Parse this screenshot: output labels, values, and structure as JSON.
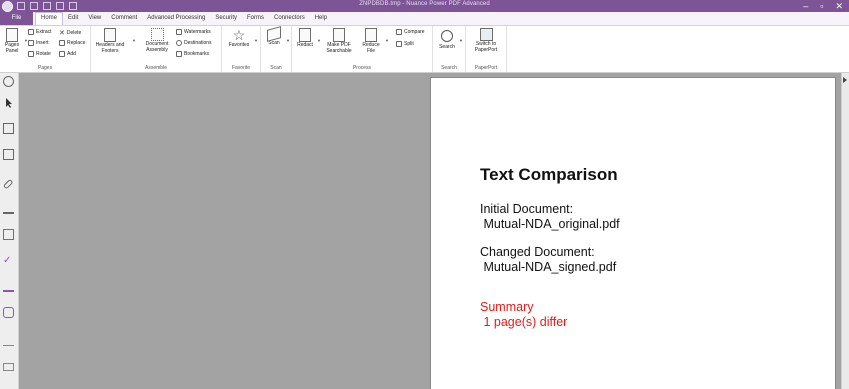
{
  "window": {
    "title": "ZNPDBDB.tmp - Nuance Power PDF Advanced",
    "min_label": "–",
    "restore_label": "▫",
    "close_label": "✕"
  },
  "menu": {
    "file": "File",
    "tabs": [
      "Home",
      "Edit",
      "View",
      "Comment",
      "Advanced Processing",
      "Security",
      "Forms",
      "Connectors",
      "Help"
    ]
  },
  "ribbon": {
    "pages_panel": "Pages Panel",
    "extract": "Extract",
    "delete": "Delete",
    "insert": "Insert",
    "replace": "Replace",
    "rotate": "Rotate",
    "add": "Add",
    "pages_group": "Pages",
    "headers_footers": "Headers and Footers",
    "document_assembly": "Document Assembly",
    "watermarks": "Watermarks",
    "destinations": "Destinations",
    "bookmarks": "Bookmarks",
    "assemble_group": "Assemble",
    "favorites": "Favorites",
    "favorite_group": "Favorite",
    "scan": "Scan",
    "scan_group": "Scan",
    "redact": "Redact",
    "make_pdf_searchable": "Make PDF Searchable",
    "reduce_file": "Reduce File",
    "compare": "Compare",
    "split": "Split",
    "process_group": "Process",
    "search": "Search",
    "search_group": "Search",
    "switch_paperport": "Switch to PaperPort",
    "paperport_group": "PaperPort"
  },
  "document": {
    "heading": "Text Comparison",
    "initial_label": "Initial Document:",
    "initial_file": " Mutual-NDA_original.pdf",
    "changed_label": "Changed Document:",
    "changed_file": " Mutual-NDA_signed.pdf",
    "summary_label": "Summary",
    "summary_text": " 1 page(s) differ"
  },
  "colors": {
    "accent": "#7d5597",
    "summary": "#e11b1b",
    "workspace": "#a3a3a3"
  }
}
